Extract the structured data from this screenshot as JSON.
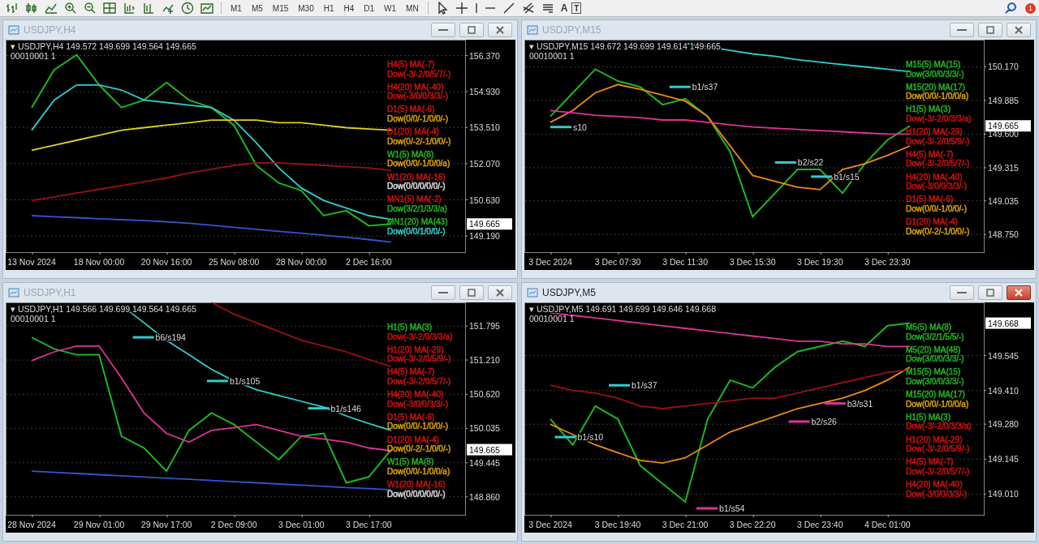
{
  "toolbar": {
    "timeframes": [
      {
        "label": "M1",
        "selected": false
      },
      {
        "label": "M5",
        "selected": false
      },
      {
        "label": "M15",
        "selected": false
      },
      {
        "label": "M30",
        "selected": false
      },
      {
        "label": "H1",
        "selected": false
      },
      {
        "label": "H4",
        "selected": false
      },
      {
        "label": "D1",
        "selected": false
      },
      {
        "label": "W1",
        "selected": false
      },
      {
        "label": "MN",
        "selected": false
      }
    ],
    "text_tools": [
      "A",
      "T"
    ],
    "notification_count": "1"
  },
  "windows": [
    {
      "title": "USDJPY,H4",
      "active": false,
      "price_tag": "149.665",
      "info": [
        "▾ USDJPY,H4 149.572 149.699 149.564 149.665",
        "00010001 1"
      ],
      "legend": [
        {
          "text": "H4(5) MA(-7)",
          "color": "#cc1111"
        },
        {
          "text": "Dow(-3/-2/0/5/7/-)",
          "color": "#cc1111"
        },
        {
          "text": "H4(20) MA(-40)",
          "color": "#cc1111"
        },
        {
          "text": "Dow(-3/0/0/3/3/-)",
          "color": "#cc1111"
        },
        {
          "text": "D1(5) MA(-6)",
          "color": "#cc1111"
        },
        {
          "text": "Dow(0/0/-1/0/0/-)",
          "color": "#d9a000"
        },
        {
          "text": "D1(20) MA(-4)",
          "color": "#cc1111"
        },
        {
          "text": "Dow(0/-2/-1/0/0/-)",
          "color": "#d9a000"
        },
        {
          "text": "W1(5) MA(8)",
          "color": "#22b022"
        },
        {
          "text": "Dow(0/0/-1/0/0/a)",
          "color": "#d9a000"
        },
        {
          "text": "W1(20) MA(-16)",
          "color": "#cc1111"
        },
        {
          "text": "Dow(0/0/0/0/0/-)",
          "color": "#dddddd"
        },
        {
          "text": "MN1(5) MA(-2)",
          "color": "#cc1111"
        },
        {
          "text": "Dow(3/2/1/3/3/a)",
          "color": "#22b022"
        },
        {
          "text": "MN1(20) MA(43)",
          "color": "#22b022"
        },
        {
          "text": "Dow(0/0/1/0/0/-)",
          "color": "#33cccc"
        }
      ],
      "chart_data": {
        "type": "line",
        "grid": true,
        "ylim": [
          148.55,
          157.0
        ],
        "categories": [
          "13 Nov 2024",
          null,
          null,
          "18 Nov 00:00",
          null,
          null,
          "20 Nov 16:00",
          null,
          null,
          "25 Nov 08:00",
          null,
          null,
          "28 Nov 00:00",
          null,
          null,
          "2 Dec 16:00",
          null,
          null,
          null
        ],
        "yticks": [
          {
            "value": 156.37,
            "label": "156.370"
          },
          {
            "value": 154.93,
            "label": "154.930"
          },
          {
            "value": 153.51,
            "label": "153.510"
          },
          {
            "value": 152.07,
            "label": "152.070"
          },
          {
            "value": 150.63,
            "label": "150.630"
          },
          {
            "value": 149.19,
            "label": "149.190"
          }
        ],
        "series": [
          {
            "color": "#1fb51f",
            "values": [
              154.3,
              155.8,
              156.4,
              155.2,
              154.3,
              154.6,
              155.3,
              154.6,
              154.3,
              153.6,
              152.0,
              151.3,
              151.0,
              150.0,
              150.2,
              149.6,
              149.67,
              null,
              null
            ]
          },
          {
            "color": "#33cccc",
            "values": [
              153.4,
              154.6,
              155.2,
              155.2,
              155.0,
              154.6,
              154.5,
              154.4,
              154.3,
              153.8,
              152.9,
              151.9,
              151.1,
              150.6,
              150.3,
              150.0,
              149.85,
              null,
              null
            ]
          },
          {
            "color": "#e0d020",
            "values": [
              152.6,
              152.8,
              153.0,
              153.2,
              153.4,
              153.5,
              153.6,
              153.7,
              153.8,
              153.8,
              153.8,
              153.7,
              153.7,
              153.6,
              153.5,
              153.45,
              153.4,
              null,
              null
            ]
          },
          {
            "color": "#991111",
            "values": [
              150.6,
              150.75,
              150.9,
              151.05,
              151.2,
              151.35,
              151.5,
              151.7,
              151.85,
              152.0,
              152.1,
              152.1,
              152.05,
              152.0,
              151.95,
              151.9,
              151.8,
              null,
              null
            ]
          },
          {
            "color": "#3355cc",
            "values": [
              150.0,
              149.96,
              149.92,
              149.88,
              149.84,
              149.8,
              149.76,
              149.7,
              149.62,
              149.54,
              149.46,
              149.38,
              149.3,
              149.22,
              149.14,
              149.05,
              148.95,
              null,
              null
            ]
          }
        ]
      }
    },
    {
      "title": "USDJPY,M15",
      "active": false,
      "price_tag": "149.665",
      "info": [
        "▾ USDJPY,M15 149.672 149.699 149.614 149.665",
        "00010001 1"
      ],
      "markers": [
        {
          "text": "s10",
          "color": "#33cccc"
        },
        {
          "text": "b1/s37",
          "color": "#33cccc"
        },
        {
          "text": "b2/s22",
          "color": "#33cccc"
        },
        {
          "text": "b1/s15",
          "color": "#33cccc"
        }
      ],
      "legend": [
        {
          "text": "M15(5) MA(15)",
          "color": "#22b022"
        },
        {
          "text": "Dow(3/0/0/3/3/-)",
          "color": "#22b022"
        },
        {
          "text": "M15(20) MA(17)",
          "color": "#22b022"
        },
        {
          "text": "Dow(0/0/-1/0/0/a)",
          "color": "#d9a000"
        },
        {
          "text": "H1(5) MA(3)",
          "color": "#22b022"
        },
        {
          "text": "Dow(-3/-2/0/3/3/a)",
          "color": "#cc1111"
        },
        {
          "text": "H1(20) MA(-29)",
          "color": "#cc1111"
        },
        {
          "text": "Dow(-3/-2/0/5/9/-)",
          "color": "#cc1111"
        },
        {
          "text": "H4(5) MA(-7)",
          "color": "#cc1111"
        },
        {
          "text": "Dow(-3/-2/0/5/7/-)",
          "color": "#cc1111"
        },
        {
          "text": "H4(20) MA(-40)",
          "color": "#cc1111"
        },
        {
          "text": "Dow(-3/0/0/3/3/-)",
          "color": "#cc1111"
        },
        {
          "text": "D1(5) MA(-6)",
          "color": "#cc1111"
        },
        {
          "text": "Dow(0/0/-1/0/0/-)",
          "color": "#d9a000"
        },
        {
          "text": "D1(20) MA(-4)",
          "color": "#cc1111"
        },
        {
          "text": "Dow(0/-2/-1/0/0/-)",
          "color": "#d9a000"
        }
      ],
      "chart_data": {
        "type": "line",
        "grid": true,
        "ylim": [
          148.6,
          150.4
        ],
        "categories": [
          "3 Dec 2024",
          null,
          null,
          "3 Dec 07:30",
          null,
          null,
          "3 Dec 11:30",
          null,
          null,
          "3 Dec 15:30",
          null,
          null,
          "3 Dec 19:30",
          null,
          null,
          "3 Dec 23:30",
          null,
          null,
          null
        ],
        "yticks": [
          {
            "value": 150.17,
            "label": "150.170"
          },
          {
            "value": 149.885,
            "label": "149.885"
          },
          {
            "value": 149.6,
            "label": "149.600"
          },
          {
            "value": 149.315,
            "label": "149.315"
          },
          {
            "value": 149.035,
            "label": "149.035"
          },
          {
            "value": 148.75,
            "label": "148.750"
          }
        ],
        "series": [
          {
            "color": "#1fb51f",
            "values": [
              149.75,
              149.95,
              150.15,
              150.05,
              150.0,
              149.85,
              149.9,
              149.75,
              149.45,
              148.9,
              149.1,
              149.3,
              149.3,
              149.1,
              149.35,
              149.55,
              149.67,
              null,
              null
            ]
          },
          {
            "color": "#ee8a10",
            "values": [
              149.7,
              149.8,
              149.95,
              150.02,
              149.98,
              149.93,
              149.88,
              149.75,
              149.5,
              149.25,
              149.2,
              149.15,
              149.13,
              149.3,
              149.35,
              149.42,
              149.5,
              null,
              null
            ]
          },
          {
            "color": "#dd3399",
            "values": [
              149.8,
              149.78,
              149.76,
              149.75,
              149.74,
              149.72,
              149.72,
              149.7,
              149.68,
              149.66,
              149.65,
              149.64,
              149.63,
              149.62,
              149.61,
              149.6,
              149.6,
              null,
              null
            ]
          },
          {
            "color": "#33cccc",
            "values": [
              null,
              null,
              null,
              null,
              null,
              null,
              150.37,
              150.34,
              150.31,
              150.28,
              150.26,
              150.23,
              150.21,
              150.19,
              150.17,
              150.15,
              150.13,
              null,
              null
            ]
          }
        ]
      }
    },
    {
      "title": "USDJPY,H1",
      "active": false,
      "price_tag": "149.665",
      "info": [
        "▾ USDJPY,H1 149.566 149.699 149.564 149.665",
        "00010001 1"
      ],
      "markers": [
        {
          "text": "b6/s194",
          "color": "#33cccc"
        },
        {
          "text": "b1/s105",
          "color": "#33cccc"
        },
        {
          "text": "b1/s146",
          "color": "#33cccc"
        }
      ],
      "legend": [
        {
          "text": "H1(5) MA(3)",
          "color": "#22b022"
        },
        {
          "text": "Dow(-3/-2/0/3/3/a)",
          "color": "#cc1111"
        },
        {
          "text": "H1(20) MA(-29)",
          "color": "#cc1111"
        },
        {
          "text": "Dow(-3/-2/0/5/9/-)",
          "color": "#cc1111"
        },
        {
          "text": "H4(5) MA(-7)",
          "color": "#cc1111"
        },
        {
          "text": "Dow(-3/-2/0/5/7/-)",
          "color": "#cc1111"
        },
        {
          "text": "H4(20) MA(-40)",
          "color": "#cc1111"
        },
        {
          "text": "Dow(-3/0/0/3/3/-)",
          "color": "#cc1111"
        },
        {
          "text": "D1(5) MA(-6)",
          "color": "#cc1111"
        },
        {
          "text": "Dow(0/0/-1/0/0/-)",
          "color": "#d9a000"
        },
        {
          "text": "D1(20) MA(-4)",
          "color": "#cc1111"
        },
        {
          "text": "Dow(0/-2/-1/0/0/-)",
          "color": "#d9a000"
        },
        {
          "text": "W1(5) MA(8)",
          "color": "#22b022"
        },
        {
          "text": "Dow(0/0/-1/0/0/a)",
          "color": "#d9a000"
        },
        {
          "text": "W1(20) MA(-16)",
          "color": "#cc1111"
        },
        {
          "text": "Dow(0/0/0/0/0/-)",
          "color": "#dddddd"
        }
      ],
      "chart_data": {
        "type": "line",
        "grid": true,
        "ylim": [
          148.55,
          152.2
        ],
        "categories": [
          "28 Nov 2024",
          null,
          null,
          "29 Nov 01:00",
          null,
          null,
          "29 Nov 17:00",
          null,
          null,
          "2 Dec 09:00",
          null,
          null,
          "3 Dec 01:00",
          null,
          null,
          "3 Dec 17:00",
          null,
          null,
          null
        ],
        "yticks": [
          {
            "value": 151.795,
            "label": "151.795"
          },
          {
            "value": 151.21,
            "label": "151.210"
          },
          {
            "value": 150.62,
            "label": "150.620"
          },
          {
            "value": 150.035,
            "label": "150.035"
          },
          {
            "value": 149.445,
            "label": "149.445"
          },
          {
            "value": 148.86,
            "label": "148.860"
          }
        ],
        "series": [
          {
            "color": "#1fb51f",
            "values": [
              151.6,
              151.4,
              151.3,
              151.3,
              149.9,
              149.7,
              149.3,
              150.0,
              150.3,
              150.1,
              149.8,
              149.5,
              149.9,
              149.95,
              149.1,
              149.2,
              149.67,
              null,
              null
            ]
          },
          {
            "color": "#33cccc",
            "values": [
              null,
              null,
              null,
              null,
              152.15,
              151.85,
              151.55,
              151.3,
              151.05,
              150.85,
              150.7,
              150.6,
              150.5,
              150.4,
              150.25,
              150.12,
              150.0,
              null,
              null
            ]
          },
          {
            "color": "#dd3399",
            "values": [
              151.2,
              151.35,
              151.45,
              151.45,
              150.9,
              150.3,
              149.95,
              149.8,
              150.0,
              150.05,
              150.1,
              150.0,
              149.9,
              149.85,
              149.8,
              149.7,
              149.65,
              null,
              null
            ]
          },
          {
            "color": "#991111",
            "values": [
              null,
              null,
              null,
              null,
              null,
              null,
              null,
              null,
              152.2,
              152.0,
              151.85,
              151.7,
              151.55,
              151.45,
              151.35,
              151.22,
              151.1,
              null,
              null
            ]
          },
          {
            "color": "#3355cc",
            "values": [
              149.3,
              149.28,
              149.26,
              149.24,
              149.22,
              149.2,
              149.18,
              149.16,
              149.14,
              149.12,
              149.1,
              149.08,
              149.06,
              149.04,
              149.02,
              149.0,
              148.98,
              null,
              null
            ]
          }
        ]
      }
    },
    {
      "title": "USDJPY,M5",
      "active": true,
      "price_tag": "149.668",
      "info": [
        "▾ USDJPY,M5 149.691 149.699 149.646 149.668",
        "00010001 1"
      ],
      "markers": [
        {
          "text": "b1/s10",
          "color": "#33cccc"
        },
        {
          "text": "b1/s37",
          "color": "#33cccc"
        },
        {
          "text": "b2/s26",
          "color": "#dd3399"
        },
        {
          "text": "b3/s31",
          "color": "#dd3399"
        },
        {
          "text": "b1/s54",
          "color": "#dd3399"
        }
      ],
      "legend": [
        {
          "text": "M5(5) MA(8)",
          "color": "#22b022"
        },
        {
          "text": "Dow(3/2/1/5/5/-)",
          "color": "#22b022"
        },
        {
          "text": "M5(20) MA(48)",
          "color": "#22b022"
        },
        {
          "text": "Dow(3/0/0/3/3/-)",
          "color": "#22b022"
        },
        {
          "text": "M15(5) MA(15)",
          "color": "#22b022"
        },
        {
          "text": "Dow(3/0/0/3/3/-)",
          "color": "#22b022"
        },
        {
          "text": "M15(20) MA(17)",
          "color": "#22b022"
        },
        {
          "text": "Dow(0/0/-1/0/0/a)",
          "color": "#d9a000"
        },
        {
          "text": "H1(5) MA(3)",
          "color": "#22b022"
        },
        {
          "text": "Dow(-3/-2/0/3/3/a)",
          "color": "#cc1111"
        },
        {
          "text": "H1(20) MA(-29)",
          "color": "#cc1111"
        },
        {
          "text": "Dow(-3/-2/0/5/9/-)",
          "color": "#cc1111"
        },
        {
          "text": "H4(5) MA(-7)",
          "color": "#cc1111"
        },
        {
          "text": "Dow(-3/-2/0/5/7/-)",
          "color": "#cc1111"
        },
        {
          "text": "H4(20) MA(-40)",
          "color": "#cc1111"
        },
        {
          "text": "Dow(-3/0/0/3/3/-)",
          "color": "#cc1111"
        }
      ],
      "chart_data": {
        "type": "line",
        "grid": true,
        "ylim": [
          148.93,
          149.75
        ],
        "categories": [
          "3 Dec 2024",
          null,
          null,
          "3 Dec 19:40",
          null,
          null,
          "3 Dec 21:00",
          null,
          null,
          "3 Dec 22:20",
          null,
          null,
          "3 Dec 23:40",
          null,
          null,
          "4 Dec 01:00",
          null,
          null,
          null
        ],
        "yticks": [
          {
            "value": 149.545,
            "label": "149.545"
          },
          {
            "value": 149.41,
            "label": "149.410"
          },
          {
            "value": 149.28,
            "label": "149.280"
          },
          {
            "value": 149.145,
            "label": "149.145"
          },
          {
            "value": 149.01,
            "label": "149.010"
          }
        ],
        "series": [
          {
            "color": "#1fb51f",
            "values": [
              149.3,
              149.2,
              149.35,
              149.3,
              149.12,
              149.05,
              148.98,
              149.3,
              149.45,
              149.42,
              149.5,
              149.56,
              149.58,
              149.6,
              149.58,
              149.66,
              149.67,
              null,
              null
            ]
          },
          {
            "color": "#ee8a10",
            "values": [
              149.28,
              149.24,
              149.2,
              149.17,
              149.14,
              149.13,
              149.15,
              149.2,
              149.25,
              149.28,
              149.31,
              149.34,
              149.36,
              149.38,
              149.41,
              149.45,
              149.5,
              null,
              null
            ]
          },
          {
            "color": "#991111",
            "values": [
              149.43,
              149.41,
              149.4,
              149.38,
              149.35,
              149.34,
              149.35,
              149.36,
              149.37,
              149.38,
              149.38,
              149.4,
              149.42,
              149.44,
              149.46,
              149.48,
              149.49,
              null,
              null
            ]
          },
          {
            "color": "#dd3399",
            "values": [
              149.71,
              149.7,
              149.69,
              149.68,
              149.67,
              149.66,
              149.65,
              149.64,
              149.63,
              149.62,
              149.61,
              149.6,
              149.6,
              149.59,
              149.59,
              149.58,
              149.58,
              null,
              null
            ]
          }
        ]
      }
    }
  ]
}
